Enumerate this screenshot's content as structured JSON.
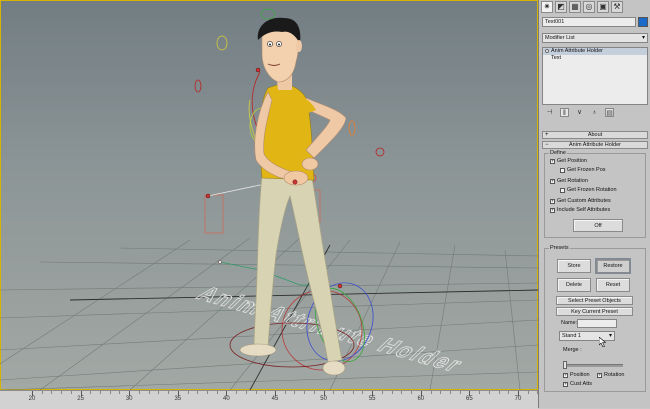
{
  "command_panel": {
    "tabs": [
      {
        "name": "create-tab-icon",
        "glyph": "✷",
        "active": true
      },
      {
        "name": "modify-tab-icon",
        "glyph": "◩",
        "active": false
      },
      {
        "name": "hierarchy-tab-icon",
        "glyph": "▦",
        "active": false
      },
      {
        "name": "motion-tab-icon",
        "glyph": "◎",
        "active": false
      },
      {
        "name": "display-tab-icon",
        "glyph": "▣",
        "active": false
      },
      {
        "name": "utilities-tab-icon",
        "glyph": "⚒",
        "active": false
      }
    ],
    "object_name": "Text001",
    "object_color": "#1e6ac8",
    "modifier_list": "Modifier List",
    "stack": [
      {
        "label": "Anim Attribute Holder",
        "selected": true
      },
      {
        "label": "Text",
        "selected": false
      }
    ],
    "stack_tools": [
      "pin-stack-icon",
      "show-end-result-icon",
      "make-unique-icon",
      "remove-modifier-icon",
      "configure-modifier-sets-icon"
    ]
  },
  "rollouts": {
    "about": "About",
    "holder": "Anim Attribute Holder"
  },
  "define": {
    "title": "Define",
    "get_position": "Get Position",
    "get_frozen_pos": "Get Frozen Pos",
    "get_rotation": "Get Rotation",
    "get_frozen_rotation": "Get Frozen Rotation",
    "get_custom_attributes": "Get Custom Attributes",
    "include_self_attributes": "Include Self Attributes",
    "button": "Off"
  },
  "presets": {
    "title": "Presets",
    "store": "Store",
    "restore": "Restore",
    "delete": "Delete",
    "reset": "Reset",
    "select_preset_objects": "Select Preset Objects",
    "key_current_preset": "Key Current Preset",
    "name_label": "Name:",
    "name_value": "",
    "preset_selected": "Stand 1",
    "merge_label": "Merge :",
    "merge_value": 0,
    "position": "Position",
    "rotation": "Rotation",
    "cust_atts": "Cust Atts"
  },
  "checks": {
    "get_position": true,
    "get_frozen_pos": false,
    "get_rotation": true,
    "get_frozen_rotation": false,
    "get_custom_attributes": true,
    "include_self_attributes": true,
    "position": true,
    "rotation": true,
    "cust_atts": true
  },
  "timeline": {
    "labels": [
      "20",
      "25",
      "30",
      "35",
      "40",
      "45",
      "50",
      "55",
      "60",
      "65",
      "70"
    ]
  },
  "viewport": {
    "scene_text": "Anim Attribute Holder",
    "accent": "#d6b400",
    "shirt": "#e0b514",
    "pants": "#d8d3b3"
  }
}
